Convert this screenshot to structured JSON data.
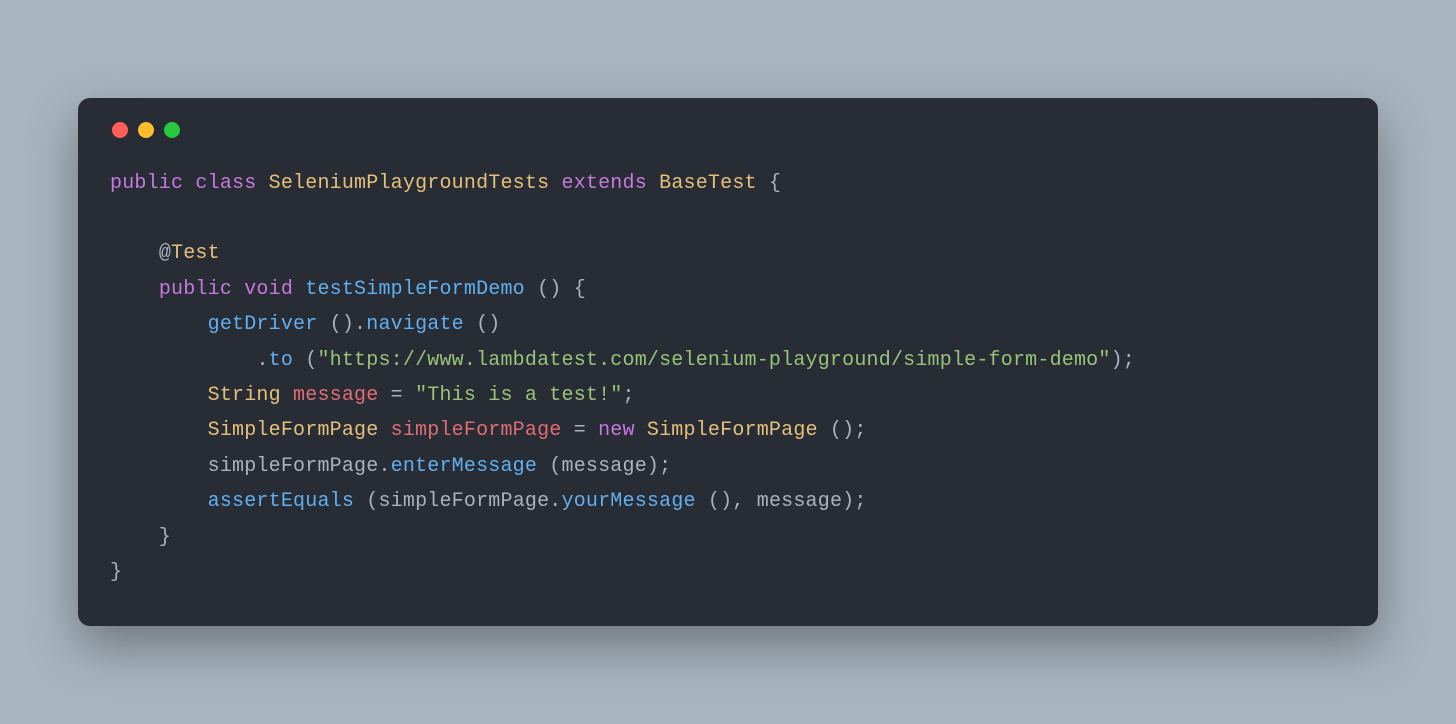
{
  "colors": {
    "background": "#a8b5bf",
    "window": "#282c34",
    "red": "#ff5f56",
    "yellow": "#ffbd2e",
    "green": "#27c93f",
    "text": "#abb2bf",
    "keyword": "#c678dd",
    "type": "#e5c07b",
    "function": "#61afef",
    "variable": "#e06c75",
    "string": "#98c379",
    "operator": "#56b6c2"
  },
  "code": {
    "l1": {
      "kw1": "public",
      "kw2": "class",
      "className": "SeleniumPlaygroundTests",
      "kw3": "extends",
      "baseClass": "BaseTest",
      "brace": " {"
    },
    "l2": "",
    "l3": {
      "at": "@",
      "ann": "Test"
    },
    "l4": {
      "kw1": "public",
      "kw2": "void",
      "fn": "testSimpleFormDemo",
      "tail": " () {"
    },
    "l5": {
      "fn1": "getDriver",
      "p1": " ().",
      "fn2": "navigate",
      "p2": " ()"
    },
    "l6": {
      "p1": ".",
      "fn": "to",
      "p2": " (",
      "str": "\"https://www.lambdatest.com/selenium-playground/simple-form-demo\"",
      "p3": ");"
    },
    "l7": {
      "type": "String",
      "var": "message",
      "op": " = ",
      "str": "\"This is a test!\"",
      "p": ";"
    },
    "l8": {
      "type1": "SimpleFormPage",
      "var": "simpleFormPage",
      "op": " = ",
      "kw": "new",
      "type2": "SimpleFormPage",
      "p": " ();"
    },
    "l9": {
      "obj": "simpleFormPage",
      "dot": ".",
      "fn": "enterMessage",
      "args": " (message);"
    },
    "l10": {
      "fn1": "assertEquals",
      "p1": " (simpleFormPage.",
      "fn2": "yourMessage",
      "p2": " (), message);"
    },
    "l11": "    }",
    "l12": "}"
  }
}
